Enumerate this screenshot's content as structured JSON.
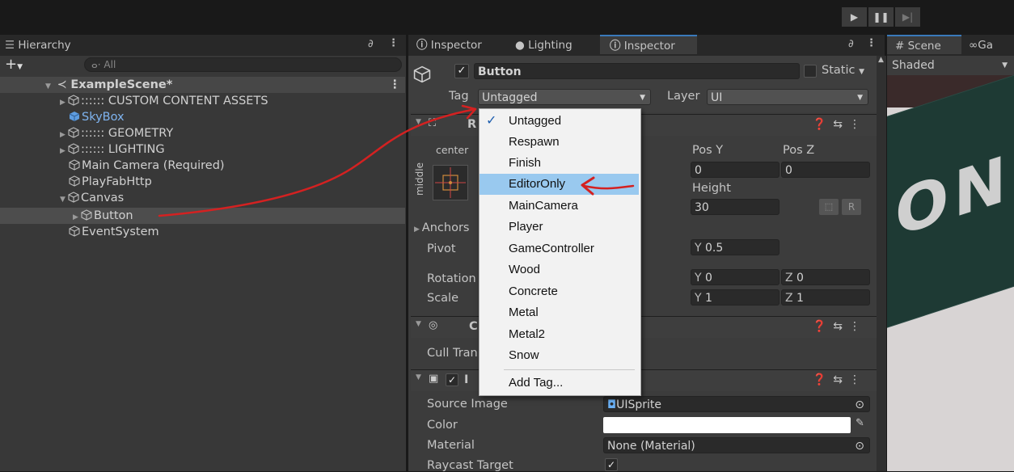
{
  "toolbar": {
    "play_icon": "play-icon",
    "pause_icon": "pause-icon",
    "step_icon": "step-icon"
  },
  "hierarchy": {
    "tab_label": "Hierarchy",
    "search_placeholder": "All",
    "scene_name": "ExampleScene*",
    "items": [
      {
        "label": ":::::: CUSTOM CONTENT ASSETS",
        "expandable": true
      },
      {
        "label": "SkyBox",
        "expandable": false,
        "prefab": true
      },
      {
        "label": ":::::: GEOMETRY",
        "expandable": true
      },
      {
        "label": ":::::: LIGHTING",
        "expandable": true
      },
      {
        "label": "Main Camera (Required)",
        "expandable": false
      },
      {
        "label": "PlayFabHttp",
        "expandable": false
      },
      {
        "label": "Canvas",
        "expandable": true,
        "expanded": true
      },
      {
        "label": "Button",
        "expandable": true,
        "selected": true
      },
      {
        "label": "EventSystem",
        "expandable": false
      }
    ]
  },
  "inspector_tabs": [
    {
      "label": "Inspector"
    },
    {
      "label": "Lighting"
    },
    {
      "label": "Inspector",
      "active": true
    }
  ],
  "inspector": {
    "object_name": "Button",
    "static_label": "Static",
    "tag_label": "Tag",
    "tag_value": "Untagged",
    "layer_label": "Layer",
    "layer_value": "UI",
    "rect": {
      "header_initial": "R",
      "anchor_top": "center",
      "anchor_side": "middle",
      "pos_y_label": "Pos Y",
      "pos_z_label": "Pos Z",
      "pos_y": "0",
      "pos_z": "0",
      "height_label": "Height",
      "height": "30",
      "anchors_label": "Anchors",
      "pivot_label": "Pivot",
      "pivot_y_axis": "Y",
      "pivot_y": "0.5",
      "rotation_label": "Rotation",
      "rot_y_axis": "Y",
      "rot_y": "0",
      "rot_z_axis": "Z",
      "rot_z": "0",
      "scale_label": "Scale",
      "scale_y_axis": "Y",
      "scale_y": "1",
      "scale_z_axis": "Z",
      "scale_z": "1",
      "r_button": "R"
    },
    "canvas_renderer": {
      "header_initial": "C",
      "cull_label": "Cull Tran"
    },
    "image": {
      "header_initial": "I",
      "source_label": "Source Image",
      "source_value": "UISprite",
      "color_label": "Color",
      "material_label": "Material",
      "material_value": "None (Material)",
      "raycast_label": "Raycast Target"
    }
  },
  "tag_dropdown": {
    "items": [
      "Untagged",
      "Respawn",
      "Finish",
      "EditorOnly",
      "MainCamera",
      "Player",
      "GameController",
      "Wood",
      "Concrete",
      "Metal",
      "Metal2",
      "Snow"
    ],
    "checked": "Untagged",
    "highlighted": "EditorOnly",
    "add_tag": "Add Tag..."
  },
  "scene": {
    "tab_scene": "Scene",
    "tab_game": "Ga",
    "shading_mode": "Shaded",
    "poster_text": "ON"
  },
  "colors": {
    "accent": "#3a79bb",
    "highlight": "#99c9ef",
    "annotation": "#d42121",
    "selected_row": "#4d4d4d"
  }
}
